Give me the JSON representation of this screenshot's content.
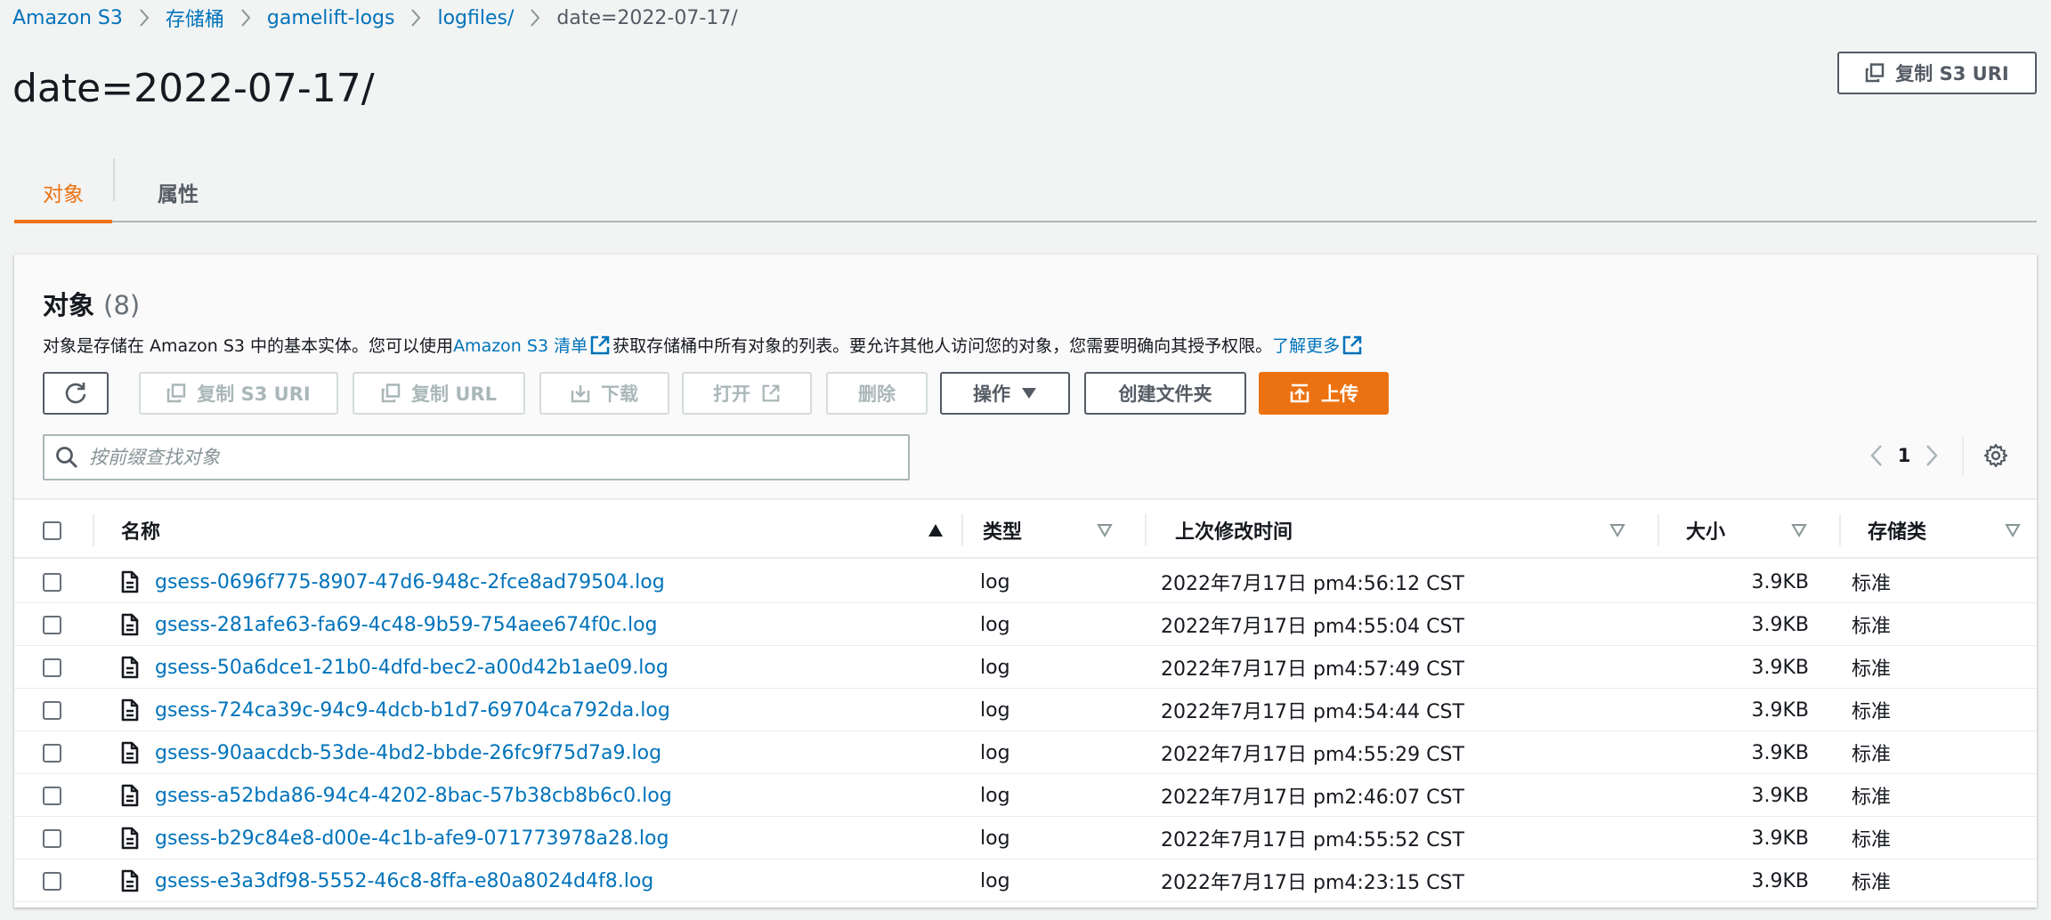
{
  "breadcrumb": [
    "Amazon S3",
    "存储桶",
    "gamelift-logs",
    "logfiles/",
    "date=2022-07-17/"
  ],
  "page_title": "date=2022-07-17/",
  "copy_s3_uri_top": "复制 S3 URI",
  "tabs": [
    {
      "label": "对象",
      "active": true
    },
    {
      "label": "属性",
      "active": false
    }
  ],
  "panel": {
    "title": "对象",
    "count": "(8)",
    "desc_before": "对象是存储在 Amazon S3 中的基本实体。您可以使用 ",
    "desc_link1": "Amazon S3 清单",
    "desc_middle": "获取存储桶中所有对象的列表。要允许其他人访问您的对象，您需要明确向其授予权限。",
    "desc_link2": "了解更多"
  },
  "toolbar": {
    "copy_s3_uri": "复制 S3 URI",
    "copy_url": "复制 URL",
    "download": "下载",
    "open": "打开",
    "delete": "删除",
    "actions": "操作",
    "create_folder": "创建文件夹",
    "upload": "上传"
  },
  "search": {
    "placeholder": "按前缀查找对象"
  },
  "pager": {
    "page": "1"
  },
  "table": {
    "columns": [
      "名称",
      "类型",
      "上次修改时间",
      "大小",
      "存储类"
    ],
    "rows": [
      {
        "name": "gsess-0696f775-8907-47d6-948c-2fce8ad79504.log",
        "type": "log",
        "modified": "2022年7月17日 pm4:56:12 CST",
        "size": "3.9KB",
        "storage": "标准"
      },
      {
        "name": "gsess-281afe63-fa69-4c48-9b59-754aee674f0c.log",
        "type": "log",
        "modified": "2022年7月17日 pm4:55:04 CST",
        "size": "3.9KB",
        "storage": "标准"
      },
      {
        "name": "gsess-50a6dce1-21b0-4dfd-bec2-a00d42b1ae09.log",
        "type": "log",
        "modified": "2022年7月17日 pm4:57:49 CST",
        "size": "3.9KB",
        "storage": "标准"
      },
      {
        "name": "gsess-724ca39c-94c9-4dcb-b1d7-69704ca792da.log",
        "type": "log",
        "modified": "2022年7月17日 pm4:54:44 CST",
        "size": "3.9KB",
        "storage": "标准"
      },
      {
        "name": "gsess-90aacdcb-53de-4bd2-bbde-26fc9f75d7a9.log",
        "type": "log",
        "modified": "2022年7月17日 pm4:55:29 CST",
        "size": "3.9KB",
        "storage": "标准"
      },
      {
        "name": "gsess-a52bda86-94c4-4202-8bac-57b38cb8b6c0.log",
        "type": "log",
        "modified": "2022年7月17日 pm2:46:07 CST",
        "size": "3.9KB",
        "storage": "标准"
      },
      {
        "name": "gsess-b29c84e8-d00e-4c1b-afe9-071773978a28.log",
        "type": "log",
        "modified": "2022年7月17日 pm4:55:52 CST",
        "size": "3.9KB",
        "storage": "标准"
      },
      {
        "name": "gsess-e3a3df98-5552-46c8-8ffa-e80a8024d4f8.log",
        "type": "log",
        "modified": "2022年7月17日 pm4:23:15 CST",
        "size": "3.9KB",
        "storage": "标准"
      }
    ]
  },
  "colors": {
    "accent": "#ec7211",
    "link": "#0073bb",
    "text": "#16191f",
    "muted": "#545b64"
  }
}
